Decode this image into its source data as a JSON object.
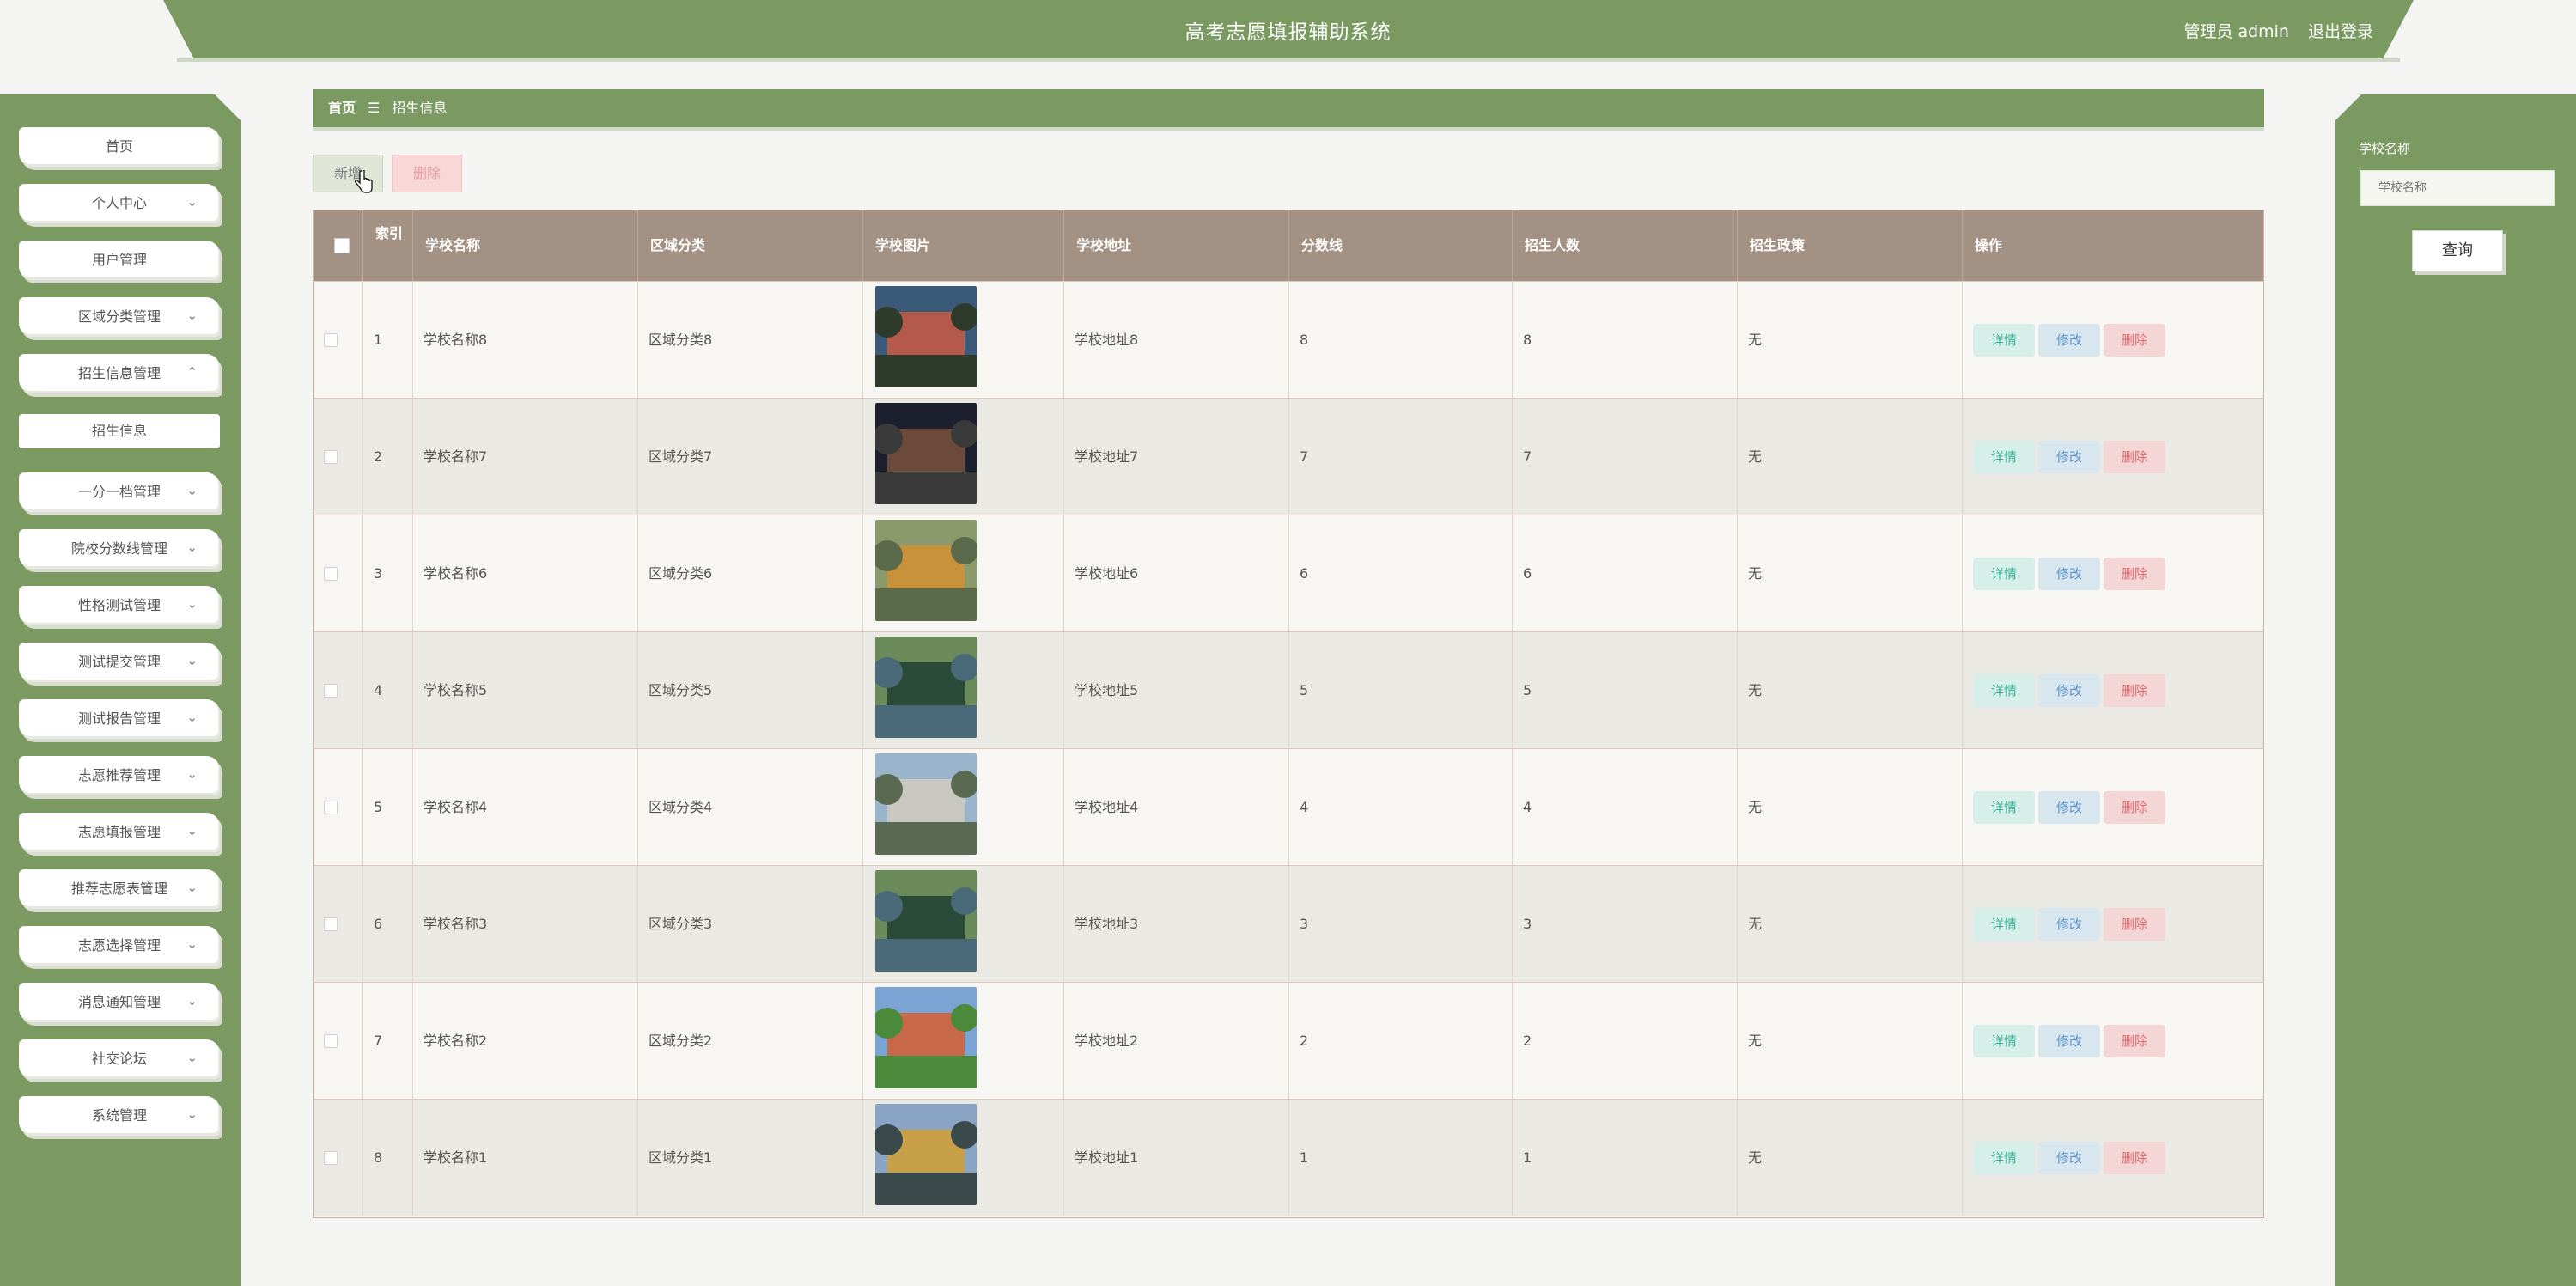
{
  "header": {
    "title": "高考志愿填报辅助系统",
    "user": "管理员 admin",
    "logout": "退出登录"
  },
  "sidebar": {
    "items": [
      {
        "label": "首页",
        "chevron": ""
      },
      {
        "label": "个人中心",
        "chevron": "⌄"
      },
      {
        "label": "用户管理",
        "chevron": ""
      },
      {
        "label": "区域分类管理",
        "chevron": "⌄"
      },
      {
        "label": "招生信息管理",
        "chevron": "⌃"
      },
      {
        "label": "一分一档管理",
        "chevron": "⌄"
      },
      {
        "label": "院校分数线管理",
        "chevron": "⌄"
      },
      {
        "label": "性格测试管理",
        "chevron": "⌄"
      },
      {
        "label": "测试提交管理",
        "chevron": "⌄"
      },
      {
        "label": "测试报告管理",
        "chevron": "⌄"
      },
      {
        "label": "志愿推荐管理",
        "chevron": "⌄"
      },
      {
        "label": "志愿填报管理",
        "chevron": "⌄"
      },
      {
        "label": "推荐志愿表管理",
        "chevron": "⌄"
      },
      {
        "label": "志愿选择管理",
        "chevron": "⌄"
      },
      {
        "label": "消息通知管理",
        "chevron": "⌄"
      },
      {
        "label": "社交论坛",
        "chevron": "⌄"
      },
      {
        "label": "系统管理",
        "chevron": "⌄"
      }
    ],
    "submenu": {
      "label": "招生信息"
    }
  },
  "breadcrumb": {
    "home": "首页",
    "sep": "☰",
    "current": "招生信息"
  },
  "toolbar": {
    "add_label": "新增",
    "delete_label": "删除"
  },
  "table": {
    "columns": [
      "",
      "索引",
      "学校名称",
      "区域分类",
      "学校图片",
      "学校地址",
      "分数线",
      "招生人数",
      "招生政策",
      "操作"
    ],
    "rows": [
      {
        "idx": "1",
        "name": "学校名称8",
        "region": "区域分类8",
        "address": "学校地址8",
        "score": "8",
        "count": "8",
        "policy": "无"
      },
      {
        "idx": "2",
        "name": "学校名称7",
        "region": "区域分类7",
        "address": "学校地址7",
        "score": "7",
        "count": "7",
        "policy": "无"
      },
      {
        "idx": "3",
        "name": "学校名称6",
        "region": "区域分类6",
        "address": "学校地址6",
        "score": "6",
        "count": "6",
        "policy": "无"
      },
      {
        "idx": "4",
        "name": "学校名称5",
        "region": "区域分类5",
        "address": "学校地址5",
        "score": "5",
        "count": "5",
        "policy": "无"
      },
      {
        "idx": "5",
        "name": "学校名称4",
        "region": "区域分类4",
        "address": "学校地址4",
        "score": "4",
        "count": "4",
        "policy": "无"
      },
      {
        "idx": "6",
        "name": "学校名称3",
        "region": "区域分类3",
        "address": "学校地址3",
        "score": "3",
        "count": "3",
        "policy": "无"
      },
      {
        "idx": "7",
        "name": "学校名称2",
        "region": "区域分类2",
        "address": "学校地址2",
        "score": "2",
        "count": "2",
        "policy": "无"
      },
      {
        "idx": "8",
        "name": "学校名称1",
        "region": "区域分类1",
        "address": "学校地址1",
        "score": "1",
        "count": "1",
        "policy": "无"
      }
    ],
    "actions": {
      "detail": "详情",
      "edit": "修改",
      "delete": "删除"
    }
  },
  "search": {
    "label": "学校名称",
    "placeholder": "学校名称",
    "button": "查询"
  },
  "colors": {
    "brand_green": "#7a9a62",
    "table_header": "#a39183",
    "detail": "#3bb39b",
    "edit": "#5b93c7",
    "danger": "#e06a6a"
  }
}
